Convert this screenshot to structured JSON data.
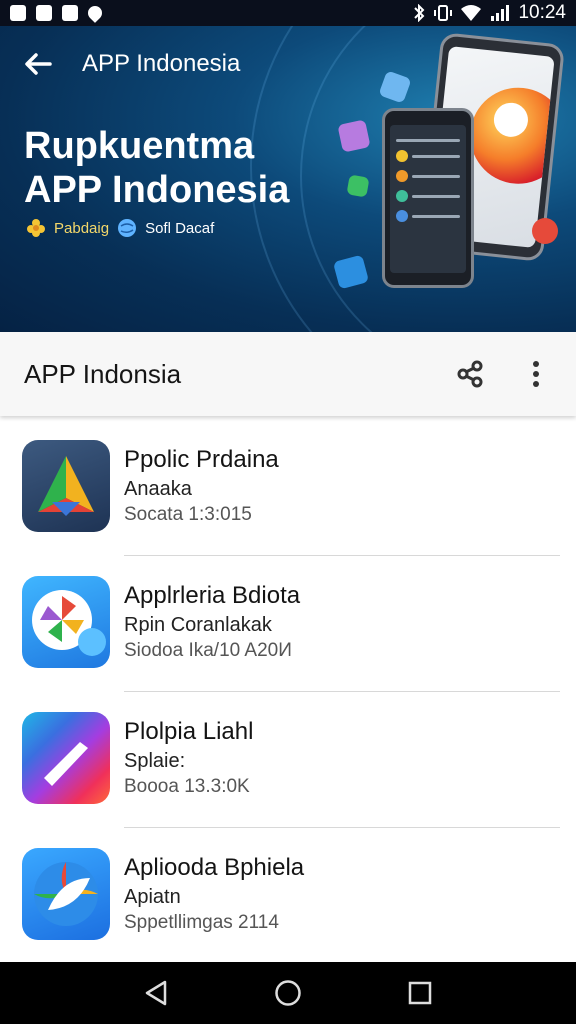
{
  "status_bar": {
    "time": "10:24",
    "left_icons": [
      "gallery-icon",
      "messenger-icon",
      "mail-icon",
      "map-pin-icon"
    ],
    "right_icons": [
      "bluetooth-icon",
      "vibrate-icon",
      "wifi-icon",
      "signal-icon"
    ]
  },
  "hero": {
    "top_title": "APP Indonesia",
    "title_line1": "Rupkuentma",
    "title_line2": "APP Indonesia",
    "tag1": "Pabdaig",
    "tag2": "Sofl Dacaf",
    "colors": {
      "bg_dark": "#052244",
      "bg_mid": "#0d4a7a",
      "bg_light": "#1f7fb0"
    }
  },
  "app_bar": {
    "title": "APP Indonsia",
    "share_icon": "share-icon",
    "more_icon": "more-vert-icon"
  },
  "apps": [
    {
      "name": "Ppolic Prdaina",
      "subtitle": "Anaaka",
      "meta": "Socata 1:3:015"
    },
    {
      "name": "Applrleria Bdiota",
      "subtitle": "Rpin Coranlakak",
      "meta": "Siodoa Ika/10 A20И"
    },
    {
      "name": "Plolpia Liahl",
      "subtitle": "Splaie:",
      "meta": "Boooa 13.3:0K"
    },
    {
      "name": "Apliooda Bphiela",
      "subtitle": "Apiatn",
      "meta": "Sppetllimgas 2114"
    }
  ],
  "nav": {
    "back": "nav-back-icon",
    "home": "nav-home-icon",
    "recents": "nav-recents-icon"
  }
}
